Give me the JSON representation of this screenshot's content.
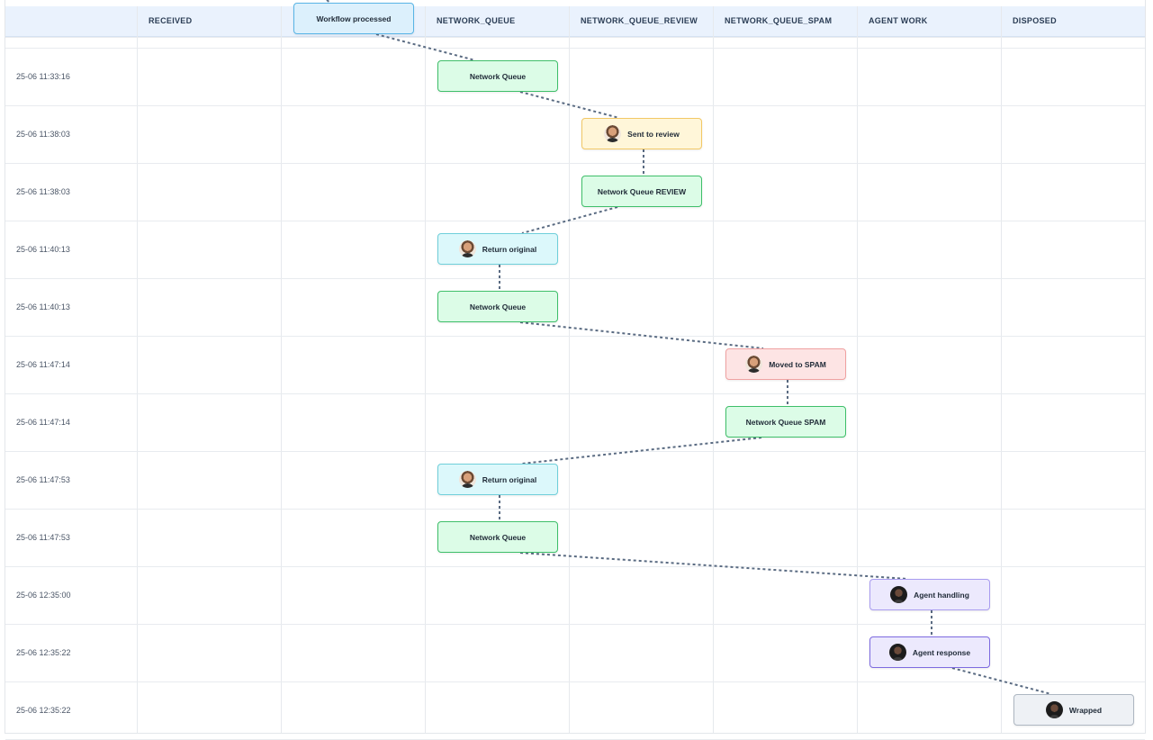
{
  "columns": [
    "",
    "RECEIVED",
    "",
    "NETWORK_QUEUE",
    "NETWORK_QUEUE_REVIEW",
    "NETWORK_QUEUE_SPAM",
    "AGENT WORK",
    "DISPOSED"
  ],
  "rows": [
    {
      "time": "25-06 11:33:16"
    },
    {
      "time": "25-06 11:38:03"
    },
    {
      "time": "25-06 11:38:03"
    },
    {
      "time": "25-06 11:40:13"
    },
    {
      "time": "25-06 11:40:13"
    },
    {
      "time": "25-06 11:47:14"
    },
    {
      "time": "25-06 11:47:14"
    },
    {
      "time": "25-06 11:47:53"
    },
    {
      "time": "25-06 11:47:53"
    },
    {
      "time": "25-06 12:35:00"
    },
    {
      "time": "25-06 12:35:22"
    },
    {
      "time": "25-06 12:35:22"
    }
  ],
  "events": [
    {
      "label": "Workflow processed",
      "col": 2,
      "row": -1,
      "theme": "blue",
      "avatar": ""
    },
    {
      "label": "Network Queue",
      "col": 3,
      "row": 0,
      "theme": "green",
      "avatar": ""
    },
    {
      "label": "Sent to review",
      "col": 4,
      "row": 1,
      "theme": "yellow",
      "avatar": "avatar-light-icon"
    },
    {
      "label": "Network Queue REVIEW",
      "col": 4,
      "row": 2,
      "theme": "green",
      "avatar": ""
    },
    {
      "label": "Return original",
      "col": 3,
      "row": 3,
      "theme": "cyan",
      "avatar": "avatar-light-icon"
    },
    {
      "label": "Network Queue",
      "col": 3,
      "row": 4,
      "theme": "green",
      "avatar": ""
    },
    {
      "label": "Moved to SPAM",
      "col": 5,
      "row": 5,
      "theme": "red",
      "avatar": "avatar-light-icon"
    },
    {
      "label": "Network Queue SPAM",
      "col": 5,
      "row": 6,
      "theme": "green",
      "avatar": ""
    },
    {
      "label": "Return original",
      "col": 3,
      "row": 7,
      "theme": "cyan",
      "avatar": "avatar-light-icon"
    },
    {
      "label": "Network Queue",
      "col": 3,
      "row": 8,
      "theme": "green",
      "avatar": ""
    },
    {
      "label": "Agent handling",
      "col": 6,
      "row": 9,
      "theme": "purple",
      "avatar": "avatar-dark-icon"
    },
    {
      "label": "Agent response",
      "col": 6,
      "row": 10,
      "theme": "purple2",
      "avatar": "avatar-dark-icon"
    },
    {
      "label": "Wrapped",
      "col": 7,
      "row": 11,
      "theme": "gray",
      "avatar": "avatar-dark-icon"
    }
  ],
  "colors": {
    "header_bg": "#eaf2fd",
    "connector": "#5a6b82",
    "green": "#3fbf6a",
    "yellow": "#f2c866",
    "cyan": "#6fcfda",
    "red": "#f0a2a2",
    "purple": "#a99cf0",
    "gray": "#aeb7c2",
    "blue": "#58b4e6"
  }
}
